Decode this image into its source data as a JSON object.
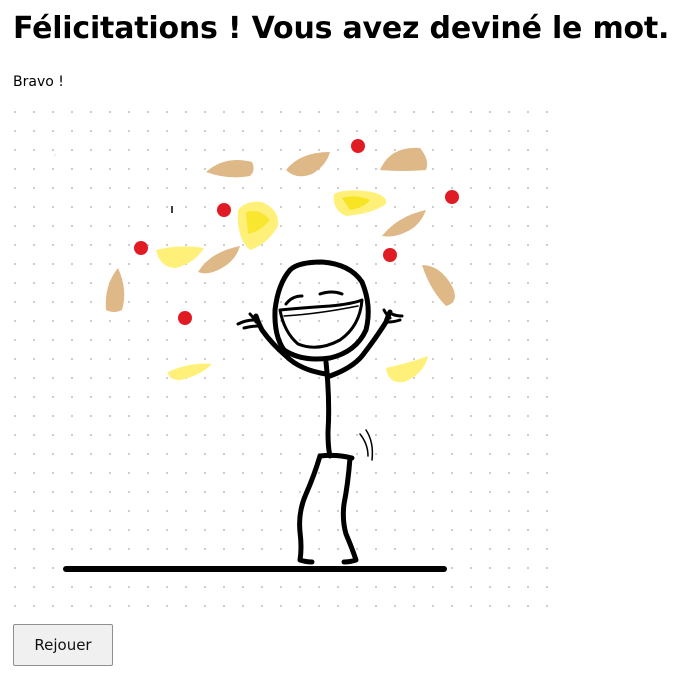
{
  "page": {
    "title": "Félicitations ! Vous avez deviné le mot.",
    "message": "Bravo !"
  },
  "actions": {
    "replay_label": "Rejouer"
  },
  "colors": {
    "ink": "#000000",
    "confetti_red": "#e01b24",
    "confetti_tan": "#deb887",
    "confetti_yellow": "#fff07a",
    "grid_dot": "#c8c8c8",
    "button_bg": "#f0f0f0"
  },
  "illustration": {
    "subject": "stick-figure-celebrating-with-confetti"
  }
}
